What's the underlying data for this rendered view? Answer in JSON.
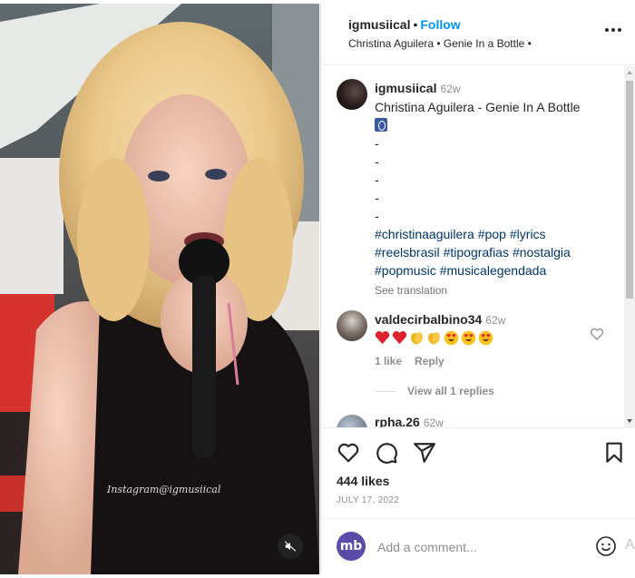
{
  "post": {
    "username": "igmusiical",
    "follow_label": "Follow",
    "audio_label": "Christina Aguilera • Genie In a Bottle •",
    "watermark": "Instagram@igmusiical"
  },
  "caption": {
    "username": "igmusiical",
    "time": "62w",
    "title": "Christina Aguilera - Genie In A Bottle",
    "dashes": [
      "-",
      "-",
      "-",
      "-",
      "-"
    ],
    "hashtags": [
      "#christinaaguilera",
      "#pop",
      "#lyrics",
      "#reelsbrasil",
      "#tipografias",
      "#nostalgia",
      "#popmusic",
      "#musicalegendada"
    ],
    "see_translation": "See translation"
  },
  "comments": [
    {
      "username": "valdecirbalbino34",
      "time": "62w",
      "emojis": [
        "red-heart",
        "red-heart",
        "clapping-hands",
        "clapping-hands",
        "heart-eyes",
        "heart-eyes",
        "heart-eyes"
      ],
      "likes_label": "1 like",
      "reply_label": "Reply",
      "view_replies": "View all 1 replies"
    },
    {
      "username": "rpha.26",
      "time": "62w"
    }
  ],
  "stats": {
    "likes": "444 likes",
    "date": "JULY 17, 2022"
  },
  "composer": {
    "avatar_text": "mb",
    "placeholder": "Add a comment...",
    "edge_glyph": "A"
  },
  "icons": [
    "more-icon",
    "heart-icon",
    "comment-icon",
    "share-icon",
    "bookmark-icon",
    "mute-icon",
    "emoji-icon"
  ],
  "colors": {
    "accent": "#0095f6",
    "hashtag": "#00376b",
    "muted": "#8e8e8e",
    "heart_red": "#ed4956"
  }
}
